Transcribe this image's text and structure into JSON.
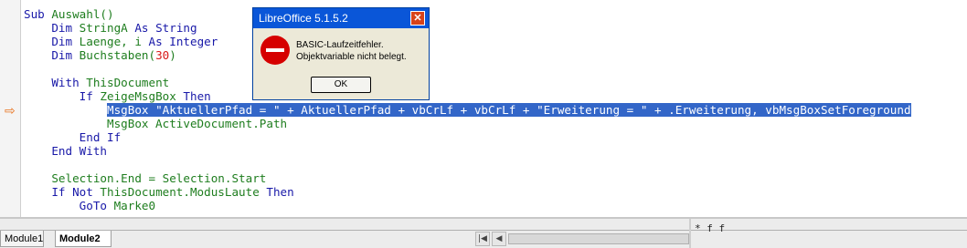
{
  "code_lines": [
    [
      "",
      [
        [
          "kw",
          "Sub "
        ],
        [
          "t",
          "Auswahl()"
        ]
      ]
    ],
    [
      "",
      [
        [
          "kw",
          "    Dim "
        ],
        [
          "t",
          "StringA "
        ],
        [
          "kw",
          "As String"
        ]
      ]
    ],
    [
      "",
      [
        [
          "kw",
          "    Dim "
        ],
        [
          "t",
          "Laenge, i "
        ],
        [
          "kw",
          "As Integer"
        ]
      ]
    ],
    [
      "",
      [
        [
          "kw",
          "    Dim "
        ],
        [
          "t",
          "Buchstaben("
        ],
        [
          "num",
          "30"
        ],
        [
          "t",
          ")"
        ]
      ]
    ],
    [
      "",
      [
        [
          "t",
          ""
        ]
      ]
    ],
    [
      "",
      [
        [
          "kw",
          "    With "
        ],
        [
          "t",
          "ThisDocument"
        ]
      ]
    ],
    [
      "",
      [
        [
          "kw",
          "        If "
        ],
        [
          "t",
          "ZeigeMsgBox "
        ],
        [
          "kw",
          "Then"
        ]
      ]
    ],
    [
      "sel",
      [
        [
          "t",
          "            MsgBox \"AktuellerPfad = \" + AktuellerPfad + vbCrLf + vbCrLf + \"Erweiterung = \" + .Erweiterung, vbMsgBoxSetForeground"
        ]
      ]
    ],
    [
      "",
      [
        [
          "t",
          "            MsgBox ActiveDocument.Path"
        ]
      ]
    ],
    [
      "",
      [
        [
          "kw",
          "        End If"
        ]
      ]
    ],
    [
      "",
      [
        [
          "kw",
          "    End With"
        ]
      ]
    ],
    [
      "",
      [
        [
          "t",
          ""
        ]
      ]
    ],
    [
      "",
      [
        [
          "t",
          "    Selection.End = Selection.Start"
        ]
      ]
    ],
    [
      "",
      [
        [
          "kw",
          "    If Not "
        ],
        [
          "t",
          "ThisDocument.ModusLaute "
        ],
        [
          "kw",
          "Then"
        ]
      ]
    ],
    [
      "",
      [
        [
          "kw",
          "        GoTo "
        ],
        [
          "t",
          "Marke0"
        ]
      ]
    ]
  ],
  "gutter": {
    "breakpoint_marker": "arrow-right-icon",
    "marker_color": "#e8701a"
  },
  "dialog": {
    "title": "LibreOffice 5.1.5.2",
    "close_label": "✕",
    "icon": "stop-error-icon",
    "message_line1": "BASIC-Laufzeitfehler.",
    "message_line2": "Objektvariable nicht belegt.",
    "ok_label": "OK"
  },
  "tabs": {
    "tab1": "Module1",
    "tab2": "Module2"
  },
  "scroll": {
    "first": "|◀",
    "prev": "◀",
    "next": "▶",
    "last": "▶|"
  },
  "right_status": "* f f",
  "colors": {
    "keyword": "#1818a8",
    "identifier": "#1e7d1e",
    "selection": "#3366c8",
    "titlebar": "#0a56d8"
  }
}
